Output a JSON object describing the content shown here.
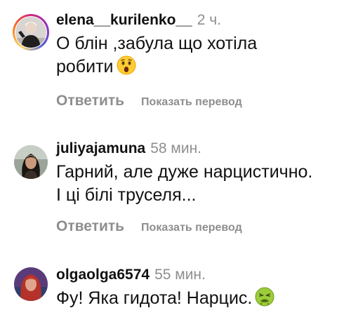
{
  "comments": [
    {
      "username": "elena__kurilenko__",
      "time": "2 ч.",
      "text_line1": "О блін ,забула що хотіла",
      "text_line2": "робити",
      "emoji": "astonished-face-icon",
      "reply_label": "Ответить",
      "translate_label": "Показать перевод"
    },
    {
      "username": "juliyajamuna",
      "time": "58 мин.",
      "text_line1": "Гарний, але дуже нарцистично.",
      "text_line2": "І ці білі труселя...",
      "reply_label": "Ответить",
      "translate_label": "Показать перевод"
    },
    {
      "username": "olgaolga6574",
      "time": "55 мин.",
      "text_line1": "Фу! Яка гидота! Нарцис.",
      "emoji": "nauseated-face-icon"
    }
  ]
}
